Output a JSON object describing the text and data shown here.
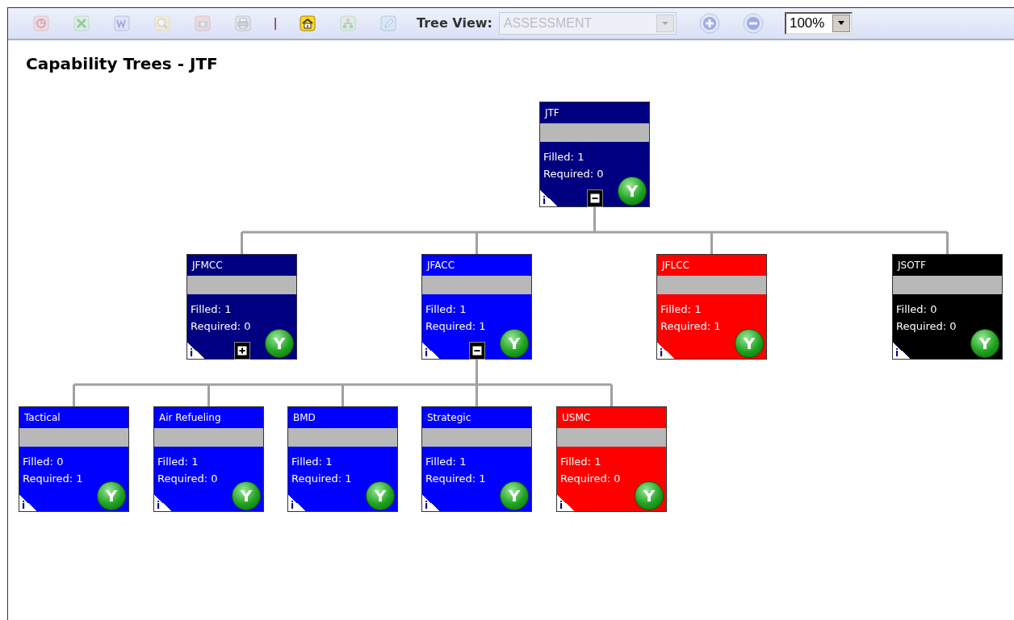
{
  "toolbar": {
    "buttons": [
      {
        "kind": "powerpoint",
        "disabled": true
      },
      {
        "kind": "excel",
        "disabled": true
      },
      {
        "kind": "word",
        "disabled": true
      },
      {
        "kind": "search",
        "disabled": true
      },
      {
        "kind": "camera",
        "disabled": true
      },
      {
        "kind": "print",
        "disabled": true
      },
      {
        "kind": "separator",
        "text": "|"
      },
      {
        "kind": "home",
        "disabled": false
      },
      {
        "kind": "hierarchy",
        "disabled": true
      },
      {
        "kind": "pencil",
        "disabled": true
      }
    ],
    "tree_view": {
      "label": "Tree View:",
      "value": "ASSESSMENT",
      "disabled": true
    },
    "zoom_in": {
      "disabled": true
    },
    "zoom_out": {
      "disabled": true
    },
    "zoom": {
      "value": "100%"
    }
  },
  "title": "Capability Trees - JTF",
  "tree": {
    "name": "JTF",
    "color": "#000080",
    "filled": "Filled: 1",
    "required": "Required: 0",
    "info": "i",
    "badge": "Y",
    "expanded": true,
    "children": [
      {
        "name": "JFMCC",
        "color": "#000080",
        "filled": "Filled: 1",
        "required": "Required: 0",
        "info": "i",
        "badge": "Y",
        "expanded": false
      },
      {
        "name": "JFACC",
        "color": "#0000ff",
        "filled": "Filled: 1",
        "required": "Required: 1",
        "info": "i",
        "badge": "Y",
        "expanded": true,
        "children": [
          {
            "name": "Tactical",
            "color": "#0000ff",
            "filled": "Filled: 0",
            "required": "Required: 1",
            "info": "i",
            "badge": "Y"
          },
          {
            "name": "Air Refueling",
            "color": "#0000ff",
            "filled": "Filled: 1",
            "required": "Required: 0",
            "info": "i",
            "badge": "Y"
          },
          {
            "name": "BMD",
            "color": "#0000ff",
            "filled": "Filled: 1",
            "required": "Required: 1",
            "info": "i",
            "badge": "Y"
          },
          {
            "name": "Strategic",
            "color": "#0000ff",
            "filled": "Filled: 1",
            "required": "Required: 1",
            "info": "i",
            "badge": "Y"
          },
          {
            "name": "USMC",
            "color": "#ff0000",
            "filled": "Filled: 1",
            "required": "Required: 0",
            "info": "i",
            "badge": "Y"
          }
        ]
      },
      {
        "name": "JFLCC",
        "color": "#ff0000",
        "filled": "Filled: 1",
        "required": "Required: 1",
        "info": "i",
        "badge": "Y"
      },
      {
        "name": "JSOTF",
        "color": "#000000",
        "filled": "Filled: 0",
        "required": "Required: 0",
        "info": "i",
        "badge": "Y"
      }
    ]
  }
}
